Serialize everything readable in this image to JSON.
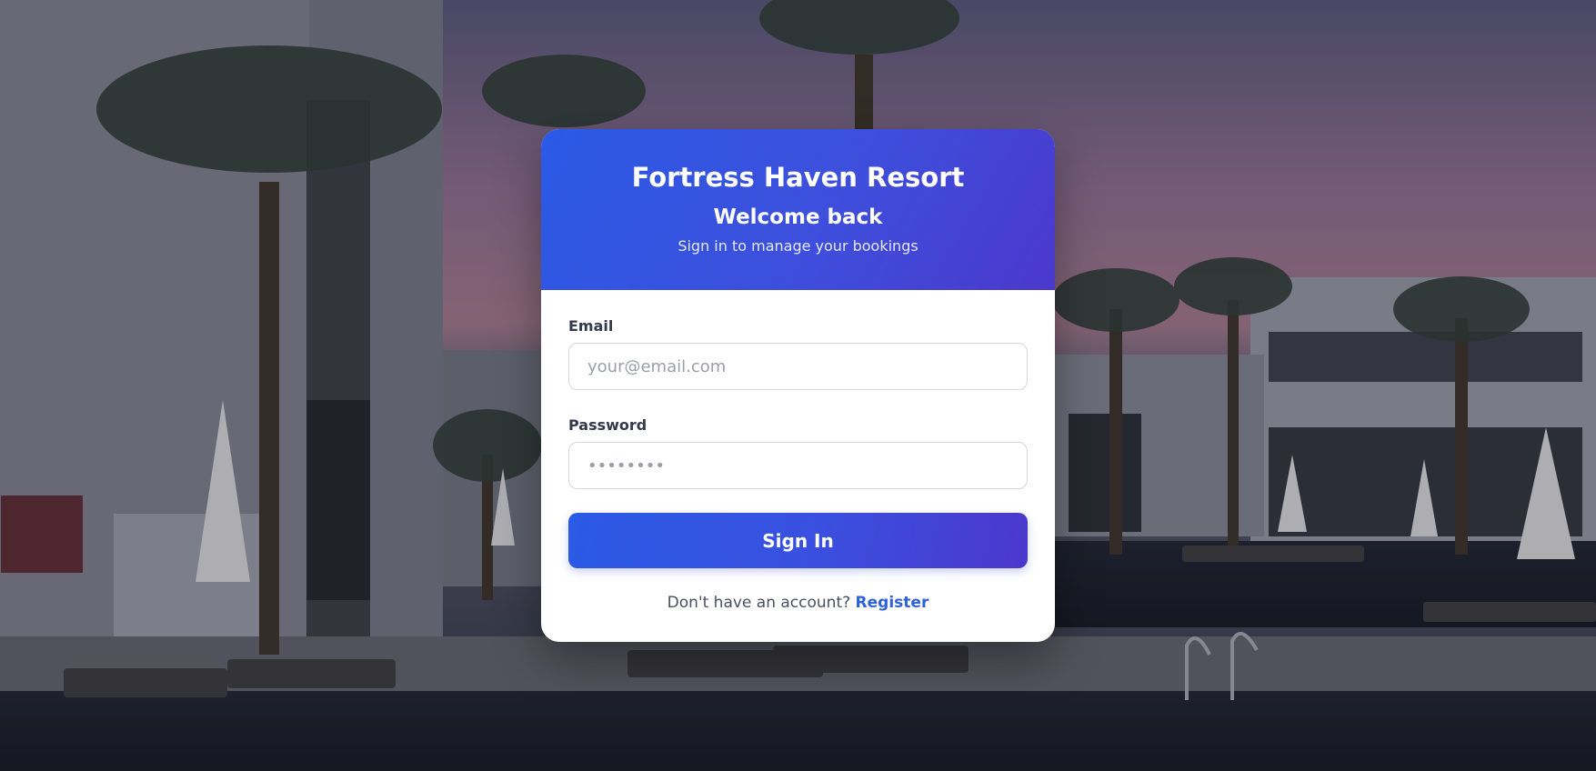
{
  "header": {
    "brand": "Fortress Haven Resort",
    "welcome": "Welcome back",
    "subtitle": "Sign in to manage your bookings"
  },
  "form": {
    "email_label": "Email",
    "email_placeholder": "your@email.com",
    "email_value": "",
    "password_label": "Password",
    "password_placeholder": "••••••••",
    "password_value": "",
    "submit_label": "Sign In"
  },
  "footer": {
    "prompt": "Don't have an account?",
    "register_label": "Register"
  },
  "colors": {
    "accent_start": "#2a5ae6",
    "accent_end": "#4b38cc",
    "link": "#2d62d8"
  },
  "icons": []
}
